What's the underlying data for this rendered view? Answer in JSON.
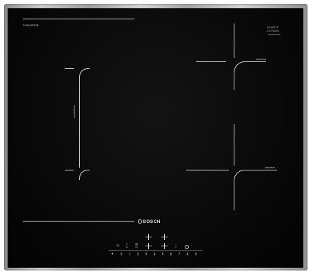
{
  "brand": {
    "name": "BOSCH"
  },
  "badge": {
    "line1": "SCHOTT",
    "line2": "CERAN",
    "line3": "Glaskeramik"
  },
  "model": {
    "number": "PVS645FB5E"
  },
  "zones": {
    "left_label": "combiZone",
    "top_right_label": "induction",
    "bottom_right_label": "induction"
  },
  "controls": {
    "icons": [
      "combi-zone-icon",
      "power-boost-icon",
      "heat-level-icon",
      "keep-warm-icon",
      "timer-icon"
    ],
    "scale": [
      "0",
      "1",
      "2",
      "3",
      "4",
      "5",
      "6",
      "7",
      "8",
      "9"
    ]
  },
  "colors": {
    "glass": "#070707",
    "frame": "#b9bbbd",
    "markings": "#d8d8d8"
  }
}
